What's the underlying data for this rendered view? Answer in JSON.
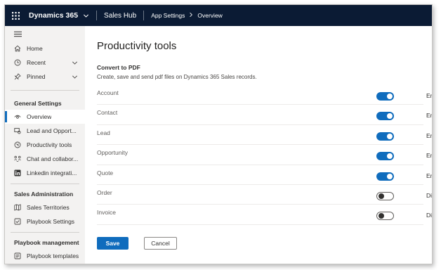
{
  "header": {
    "app_name": "Dynamics 365",
    "hub_name": "Sales Hub",
    "breadcrumb": [
      "App Settings",
      "Overview"
    ]
  },
  "sidebar": {
    "nav": [
      {
        "label": "Home",
        "icon": "home-icon"
      },
      {
        "label": "Recent",
        "icon": "clock-icon",
        "expandable": true
      },
      {
        "label": "Pinned",
        "icon": "pin-icon",
        "expandable": true
      }
    ],
    "groups": [
      {
        "title": "General Settings",
        "items": [
          {
            "label": "Overview",
            "icon": "eye-icon",
            "active": true
          },
          {
            "label": "Lead and Opport...",
            "icon": "lead-icon"
          },
          {
            "label": "Productivity tools",
            "icon": "productivity-icon"
          },
          {
            "label": "Chat and collabor...",
            "icon": "collaboration-icon"
          },
          {
            "label": "Linkedin integrati...",
            "icon": "linkedin-icon"
          }
        ]
      },
      {
        "title": "Sales Administration",
        "items": [
          {
            "label": "Sales Territories",
            "icon": "map-icon"
          },
          {
            "label": "Playbook Settings",
            "icon": "checkbox-icon"
          }
        ]
      },
      {
        "title": "Playbook management",
        "items": [
          {
            "label": "Playbook templates",
            "icon": "template-icon"
          }
        ]
      }
    ]
  },
  "main": {
    "title": "Productivity tools",
    "section_title": "Convert to PDF",
    "section_desc": "Create, save and send pdf files on Dynamics 365 Sales records.",
    "rows": [
      {
        "label": "Account",
        "enabled": true,
        "status": "Enabled"
      },
      {
        "label": "Contact",
        "enabled": true,
        "status": "Enabled"
      },
      {
        "label": "Lead",
        "enabled": true,
        "status": "Enabled"
      },
      {
        "label": "Opportunity",
        "enabled": true,
        "status": "Enabled"
      },
      {
        "label": "Quote",
        "enabled": true,
        "status": "Enabled"
      },
      {
        "label": "Order",
        "enabled": false,
        "status": "Disabled"
      },
      {
        "label": "Invoice",
        "enabled": false,
        "status": "Disabled"
      }
    ],
    "save_label": "Save",
    "cancel_label": "Cancel"
  },
  "colors": {
    "topbar": "#0b1b34",
    "accent": "#0f6cbd",
    "sidebar_bg": "#f3f2f1"
  }
}
